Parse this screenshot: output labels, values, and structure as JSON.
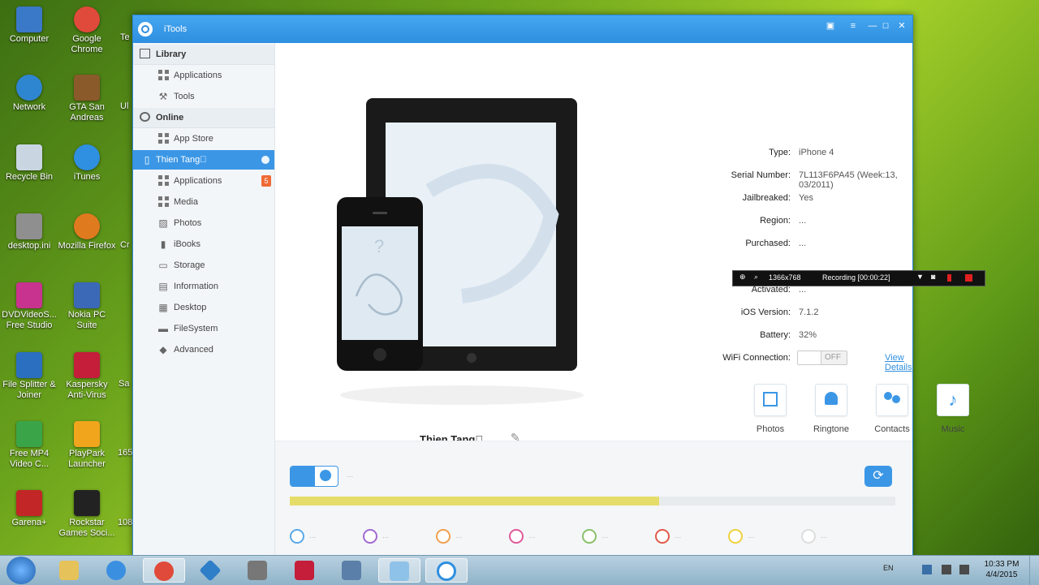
{
  "desktop": {
    "icons": [
      {
        "label": "Computer",
        "color": "#3a78c8"
      },
      {
        "label": "Network",
        "color": "#2f86d0"
      },
      {
        "label": "Recycle Bin",
        "color": "#c9d6e2"
      },
      {
        "label": "desktop.ini",
        "color": "#8f8f8f"
      },
      {
        "label": "DVDVideoS... Free Studio",
        "color": "#c8338f"
      },
      {
        "label": "File Splitter & Joiner",
        "color": "#2b6fc0"
      },
      {
        "label": "Free MP4 Video C...",
        "color": "#3aa548"
      },
      {
        "label": "Garena+",
        "color": "#c22626"
      },
      {
        "label": "Google Chrome",
        "color": "#e04a3a"
      },
      {
        "label": "GTA San Andreas",
        "color": "#8a5a2a"
      },
      {
        "label": "iTunes",
        "color": "#2f8fe0"
      },
      {
        "label": "Mozilla Firefox",
        "color": "#e07a1f"
      },
      {
        "label": "Nokia PC Suite",
        "color": "#3b69b8"
      },
      {
        "label": "Kaspersky Anti-Virus",
        "color": "#c41e3a"
      },
      {
        "label": "PlayPark Launcher",
        "color": "#f0a51c"
      },
      {
        "label": "Rockstar Games Soci...",
        "color": "#222222"
      }
    ],
    "partial": [
      "Te",
      "Ul",
      "Cr",
      "Sa",
      "165",
      "108"
    ]
  },
  "window": {
    "title": "iTools",
    "sidebar": {
      "library": {
        "label": "Library",
        "items": [
          "Applications",
          "Tools"
        ]
      },
      "online": {
        "label": "Online",
        "items": [
          "App Store"
        ]
      },
      "device": {
        "label": "Thien Tang⃞",
        "badge": "5",
        "items": [
          "Applications",
          "Media",
          "Photos",
          "iBooks",
          "Storage",
          "Information",
          "Desktop",
          "FileSystem",
          "Advanced"
        ]
      }
    },
    "device_name": "Thien Tang⃞",
    "info": [
      {
        "label": "Type:",
        "value": "iPhone 4"
      },
      {
        "label": "Serial Number:",
        "value": "7L113F6PA45 (Week:13, 03/2011)"
      },
      {
        "label": "Jailbreaked:",
        "value": "Yes"
      },
      {
        "label": "Region:",
        "value": "..."
      },
      {
        "label": "Purchased:",
        "value": "..."
      },
      {
        "label": "Activated:",
        "value": "..."
      },
      {
        "label": "iOS Version:",
        "value": "7.1.2"
      },
      {
        "label": "Battery:",
        "value": "32%"
      },
      {
        "label": "WiFi Connection:",
        "value": ""
      }
    ],
    "wifi_toggle": "OFF",
    "view_details": "View Details",
    "recording": {
      "resolution": "1366x768",
      "status": "Recording [00:00:22]"
    },
    "quick": [
      "Photos",
      "Ringtone",
      "Contacts",
      "Music"
    ],
    "storage": {
      "used_fraction": 0.61,
      "fill_color": "#e6dc6a",
      "dash": "..."
    },
    "categories": [
      {
        "color": "#5aa9e8",
        "dash": "..."
      },
      {
        "color": "#a26ad0",
        "dash": "..."
      },
      {
        "color": "#f0a050",
        "dash": "..."
      },
      {
        "color": "#e05a9a",
        "dash": "..."
      },
      {
        "color": "#8ac06a",
        "dash": "..."
      },
      {
        "color": "#e05a4a",
        "dash": "..."
      },
      {
        "color": "#f0d040",
        "dash": "..."
      },
      {
        "color": "#dddddd",
        "dash": "..."
      }
    ]
  },
  "taskbar": {
    "lang": "EN",
    "time": "10:33 PM",
    "date": "4/4/2015"
  }
}
